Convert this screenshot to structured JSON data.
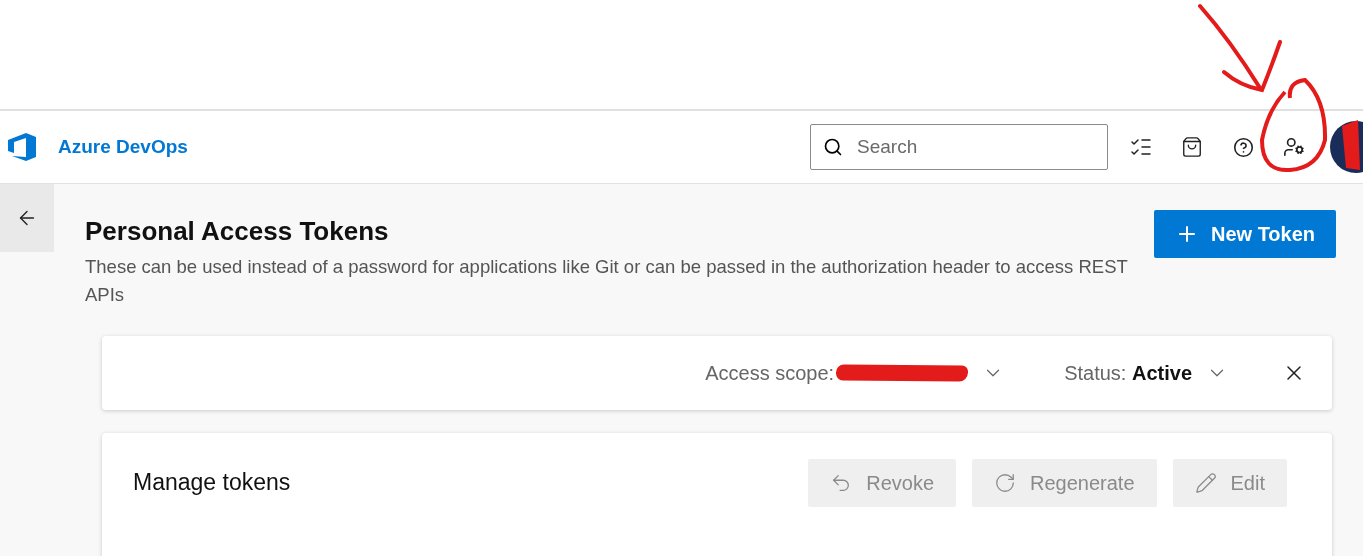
{
  "header": {
    "brand": "Azure DevOps",
    "search": {
      "placeholder": "Search"
    }
  },
  "page": {
    "title": "Personal Access Tokens",
    "description": "These can be used instead of a password for applications like Git or can be passed in the authorization header to access REST APIs",
    "new_button": "New Token"
  },
  "filters": [
    {
      "label": "Access scope:"
    },
    {
      "label": "Status:",
      "value": "Active"
    }
  ],
  "manage": {
    "title": "Manage tokens",
    "actions": [
      {
        "kind": "revoke",
        "label": "Revoke",
        "disabled": true
      },
      {
        "kind": "regenerate",
        "label": "Regenerate",
        "disabled": true
      },
      {
        "kind": "edit",
        "label": "Edit",
        "disabled": true
      }
    ]
  }
}
